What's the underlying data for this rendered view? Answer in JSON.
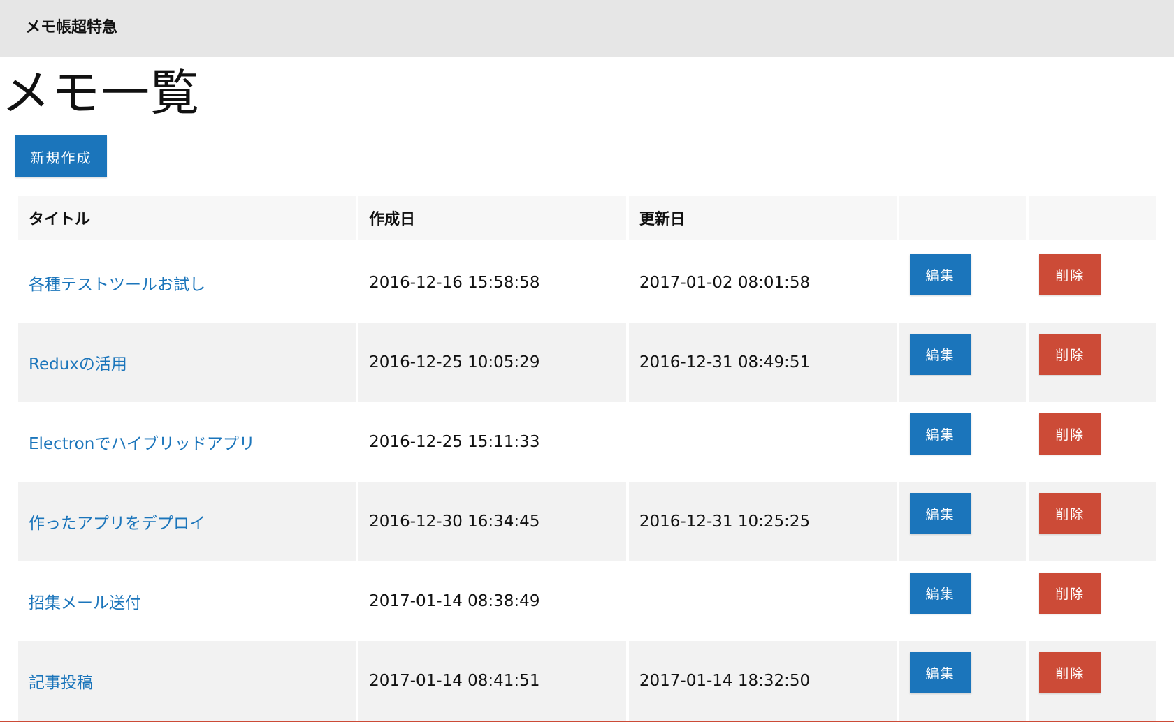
{
  "header": {
    "app_title": "メモ帳超特急"
  },
  "main": {
    "page_title": "メモ一覧",
    "new_button_label": "新規作成",
    "table": {
      "columns": [
        "タイトル",
        "作成日",
        "更新日",
        "",
        ""
      ],
      "rows": [
        {
          "title": "各種テストツールお試し",
          "created": "2016-12-16 15:58:58",
          "updated": "2017-01-02 08:01:58",
          "edit_label": "編集",
          "delete_label": "削除"
        },
        {
          "title": "Reduxの活用",
          "created": "2016-12-25 10:05:29",
          "updated": "2016-12-31 08:49:51",
          "edit_label": "編集",
          "delete_label": "削除"
        },
        {
          "title": "Electronでハイブリッドアプリ",
          "created": "2016-12-25 15:11:33",
          "updated": "",
          "edit_label": "編集",
          "delete_label": "削除"
        },
        {
          "title": "作ったアプリをデプロイ",
          "created": "2016-12-30 16:34:45",
          "updated": "2016-12-31 10:25:25",
          "edit_label": "編集",
          "delete_label": "削除"
        },
        {
          "title": "招集メール送付",
          "created": "2017-01-14 08:38:49",
          "updated": "",
          "edit_label": "編集",
          "delete_label": "削除"
        },
        {
          "title": "記事投稿",
          "created": "2017-01-14 08:41:51",
          "updated": "2017-01-14 18:32:50",
          "edit_label": "編集",
          "delete_label": "削除"
        }
      ]
    }
  },
  "colors": {
    "header_bg": "#e6e6e6",
    "primary": "#1b75bb",
    "danger": "#cc4b37",
    "row_stripe": "#f2f2f2",
    "table_header_bg": "#f7f7f7"
  }
}
